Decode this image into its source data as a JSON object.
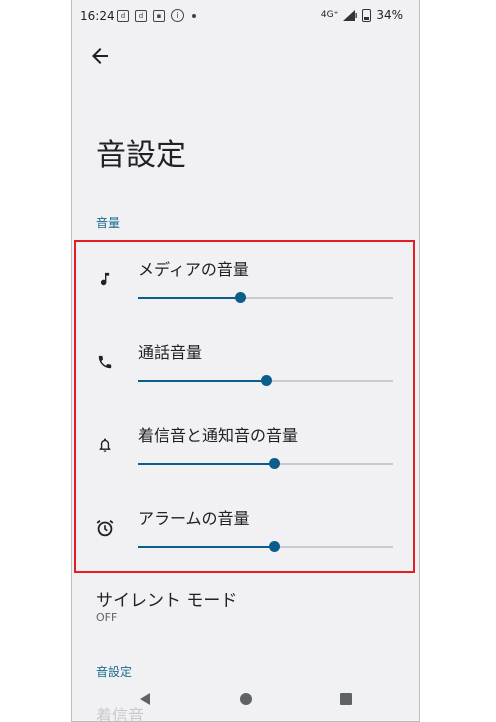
{
  "status_bar": {
    "time": "16:24",
    "network": "4G⁺",
    "battery": "34%"
  },
  "page": {
    "title": "音設定"
  },
  "volume_section": {
    "header": "音量",
    "items": [
      {
        "label": "メディアの音量",
        "level": 0.4,
        "icon": "music-note-icon"
      },
      {
        "label": "通話音量",
        "level": 0.5,
        "icon": "phone-icon"
      },
      {
        "label": "着信音と通知音の音量",
        "level": 0.535,
        "icon": "bell-icon"
      },
      {
        "label": "アラームの音量",
        "level": 0.535,
        "icon": "alarm-icon"
      }
    ]
  },
  "silent_mode": {
    "title": "サイレント モード",
    "value": "OFF"
  },
  "sound_section": {
    "header": "音設定",
    "first_item": "着信音"
  },
  "colors": {
    "accent": "#0b5e8c",
    "highlight": "#e31e24",
    "background": "#f1f1f4"
  }
}
